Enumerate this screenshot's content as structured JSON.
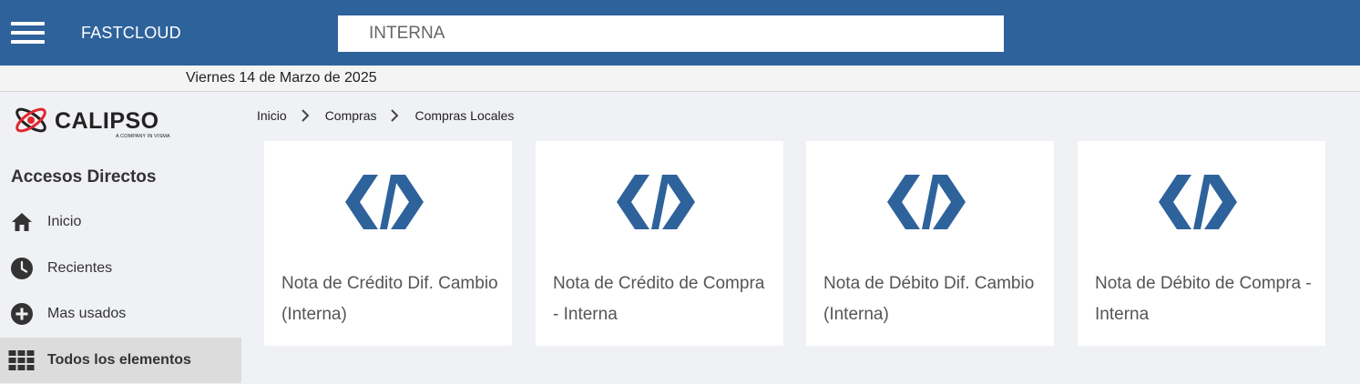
{
  "header": {
    "app_title": "FASTCLOUD",
    "search_value": "INTERNA",
    "brand_color": "#2e629b"
  },
  "date_text": "Viernes 14 de Marzo de 2025",
  "logo": {
    "word": "CALIPSO",
    "subtitle": "A COMPANY IN VISMA"
  },
  "sidebar": {
    "title": "Accesos Directos",
    "items": [
      {
        "label": "Inicio",
        "icon": "home-icon"
      },
      {
        "label": "Recientes",
        "icon": "clock-icon"
      },
      {
        "label": "Mas usados",
        "icon": "plus-circle-icon"
      },
      {
        "label": "Todos los elementos",
        "icon": "grid-icon",
        "active": true
      }
    ]
  },
  "breadcrumb": [
    "Inicio",
    "Compras",
    "Compras Locales"
  ],
  "cards": [
    {
      "title": "Nota de Crédito Dif. Cambio (Interna)",
      "icon": "visma-logo-icon"
    },
    {
      "title": "Nota de Crédito de Compra - Interna",
      "icon": "visma-logo-icon"
    },
    {
      "title": "Nota de Débito Dif. Cambio (Interna)",
      "icon": "visma-logo-icon"
    },
    {
      "title": "Nota de Débito de Compra - Interna",
      "icon": "visma-logo-icon"
    }
  ]
}
